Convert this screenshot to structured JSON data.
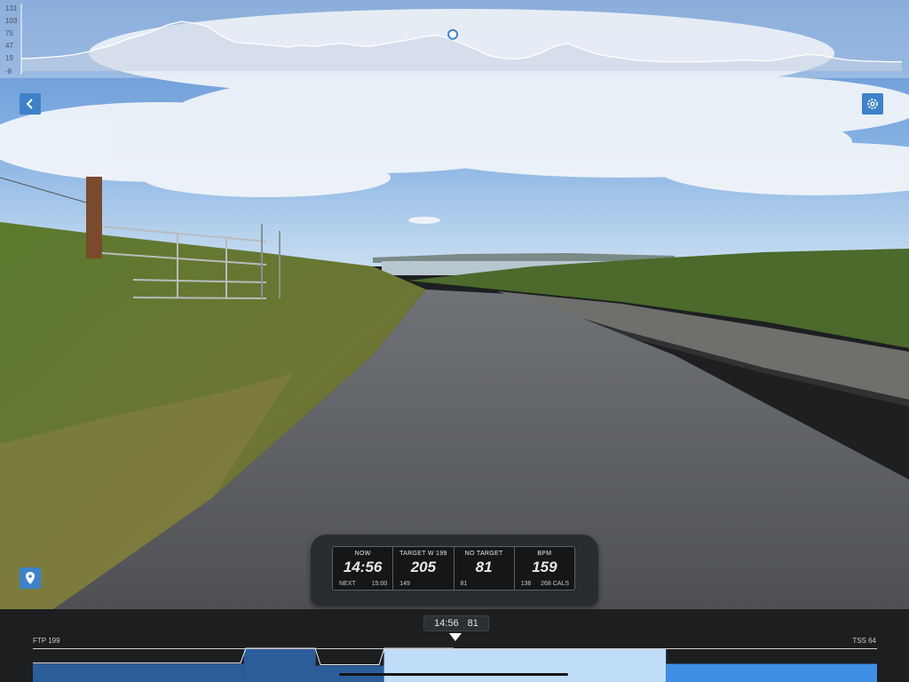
{
  "elevation": {
    "ticks": [
      "131",
      "103",
      "75",
      "47",
      "19",
      "-8"
    ],
    "profile": [
      19,
      20,
      22,
      24,
      28,
      34,
      42,
      50,
      62,
      70,
      80,
      93,
      100,
      96,
      88,
      68,
      55,
      52,
      50,
      47,
      44,
      48,
      45,
      50,
      52,
      48,
      45,
      50,
      55,
      60,
      66,
      70,
      64,
      52,
      40,
      26,
      20,
      18,
      22,
      32,
      46,
      52,
      40,
      30,
      24,
      20,
      16,
      14,
      12,
      12,
      12,
      12,
      13,
      14,
      16,
      15,
      14,
      18,
      24,
      28,
      26,
      20,
      16,
      14,
      13,
      12,
      12
    ],
    "position_fraction": 0.49
  },
  "hud": {
    "now": {
      "label": "NOW",
      "value": "14:56",
      "sub_left": "NEXT",
      "sub_right": "15:00"
    },
    "target": {
      "label": "TARGET W 199",
      "value": "205",
      "sub_left": "149"
    },
    "cadence": {
      "label": "NO TARGET",
      "value": "81",
      "sub_left": "81"
    },
    "heart": {
      "label": "BPM",
      "value": "159",
      "sub_left": "136",
      "sub_right": "268 CALS"
    }
  },
  "workout": {
    "position_time": "14:56",
    "position_value": "81",
    "ftp_label": "FTP 199",
    "tss_label": "TSS 64",
    "progress_fraction": 0.5,
    "segments": [
      {
        "start": 0.0,
        "end": 0.25,
        "level": 0.55,
        "color": "#2b5d9b"
      },
      {
        "start": 0.25,
        "end": 0.335,
        "level": 1.0,
        "color": "#2b5d9b"
      },
      {
        "start": 0.335,
        "end": 0.416,
        "level": 0.5,
        "color": "#2b5d9b"
      },
      {
        "start": 0.416,
        "end": 0.75,
        "level": 1.0,
        "color": "#bfdcf8"
      },
      {
        "start": 0.75,
        "end": 1.0,
        "level": 0.55,
        "color": "#3d8fe6"
      }
    ]
  },
  "icons": {
    "back": "chevron-left-icon",
    "settings": "gear-icon",
    "map": "map-pin-icon"
  },
  "colors": {
    "accent": "#3e82c9",
    "hud_bg": "#141618",
    "bar_bg": "#1c1e20"
  }
}
